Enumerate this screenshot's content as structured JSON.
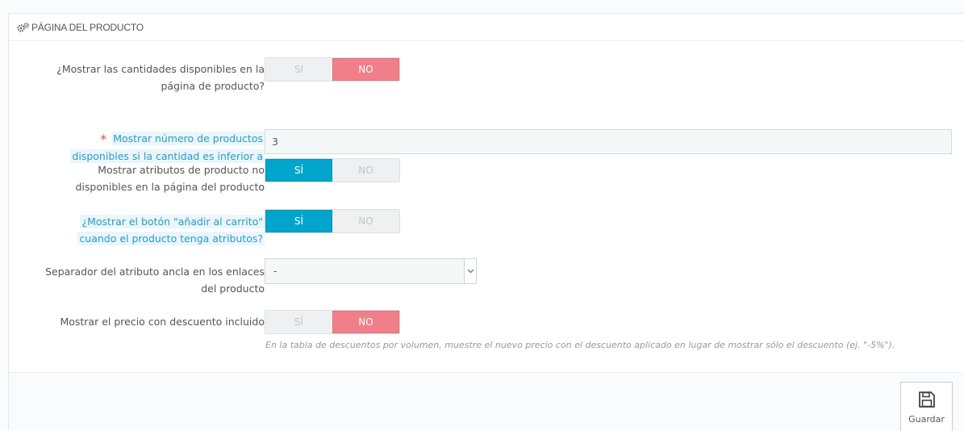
{
  "panel": {
    "title": "PÁGINA DEL PRODUCTO",
    "title_icon": "cogs-icon"
  },
  "fields": {
    "show_quantities": {
      "label_line1": "¿Mostrar las cantidades disponibles en la",
      "label_line2": "página de producto?",
      "yes": "SÍ",
      "no": "NO",
      "value": "NO"
    },
    "low_stock_threshold": {
      "required_mark": "*",
      "label_line1": "Mostrar número de productos",
      "label_line2": "disponibles si la cantidad es inferior a",
      "value": "3"
    },
    "show_unavailable_attributes": {
      "label_line1": "Mostrar atributos de producto no",
      "label_line2": "disponibles en la página del producto",
      "yes": "SÍ",
      "no": "NO",
      "value": "SÍ"
    },
    "show_add_to_cart": {
      "label_line1": "¿Mostrar el botón \"añadir al carrito\"",
      "label_line2": "cuando el producto tenga atributos?",
      "yes": "SÍ",
      "no": "NO",
      "value": "SÍ"
    },
    "anchor_separator": {
      "label_line1": "Separador del atributo ancla en los enlaces",
      "label_line2": "del producto",
      "selected": "-",
      "arrow_icon": "chevron-down-icon"
    },
    "show_discounted_price": {
      "label_line1": "Mostrar el precio con descuento incluido",
      "yes": "SÍ",
      "no": "NO",
      "value": "NO",
      "help": "En la tabla de descuentos por volumen, muestre el nuevo precio con el descuento aplicado en lugar de mostrar sólo el descuento (ej. \"-5%\")."
    }
  },
  "footer": {
    "save_label": "Guardar",
    "save_icon": "floppy-disk-icon"
  },
  "colors": {
    "active_yes": "#01a5cb",
    "active_no": "#f07f8a",
    "highlight_label": "#2a9bc3",
    "required": "#e24c4b"
  }
}
